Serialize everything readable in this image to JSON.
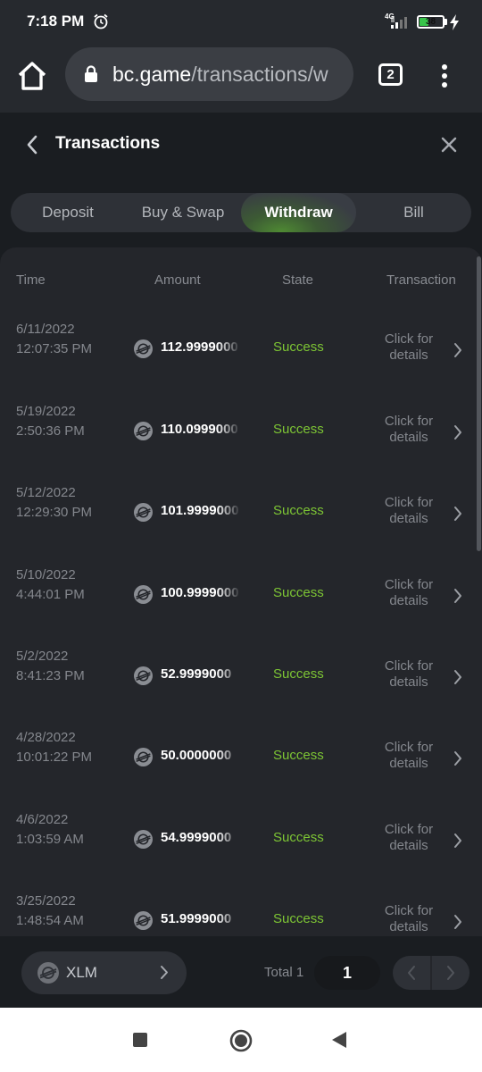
{
  "status_bar": {
    "time": "7:18 PM",
    "network": "4G",
    "battery": "38",
    "battery_level": 0.38
  },
  "browser": {
    "url_host": "bc.game",
    "url_path": "/transactions/w",
    "tab_count": "2"
  },
  "page": {
    "title": "Transactions"
  },
  "tabs": [
    {
      "label": "Deposit",
      "active": false
    },
    {
      "label": "Buy & Swap",
      "active": false
    },
    {
      "label": "Withdraw",
      "active": true
    },
    {
      "label": "Bill",
      "active": false
    }
  ],
  "table": {
    "headers": {
      "time": "Time",
      "amount": "Amount",
      "state": "State",
      "transaction": "Transaction"
    },
    "rows": [
      {
        "date": "6/11/2022",
        "time": "12:07:35 PM",
        "amount": "112.9999000",
        "state": "Success",
        "details": "Click for details"
      },
      {
        "date": "5/19/2022",
        "time": "2:50:36 PM",
        "amount": "110.0999000",
        "state": "Success",
        "details": "Click for details"
      },
      {
        "date": "5/12/2022",
        "time": "12:29:30 PM",
        "amount": "101.9999000",
        "state": "Success",
        "details": "Click for details"
      },
      {
        "date": "5/10/2022",
        "time": "4:44:01 PM",
        "amount": "100.9999000",
        "state": "Success",
        "details": "Click for details"
      },
      {
        "date": "5/2/2022",
        "time": "8:41:23 PM",
        "amount": "52.9999000",
        "state": "Success",
        "details": "Click for details"
      },
      {
        "date": "4/28/2022",
        "time": "10:01:22 PM",
        "amount": "50.0000000",
        "state": "Success",
        "details": "Click for details"
      },
      {
        "date": "4/6/2022",
        "time": "1:03:59 AM",
        "amount": "54.9999000",
        "state": "Success",
        "details": "Click for details"
      },
      {
        "date": "3/25/2022",
        "time": "1:48:54 AM",
        "amount": "51.9999000",
        "state": "Success",
        "details": "Click for details"
      }
    ]
  },
  "footer": {
    "currency": "XLM",
    "total_label": "Total 1",
    "page": "1"
  },
  "colors": {
    "accent_green": "#7dc534",
    "background": "#1a1d21",
    "panel": "#24262b"
  },
  "icons": {
    "coin": "stellar-xlm-icon",
    "row_action": "chevron-right-icon"
  }
}
